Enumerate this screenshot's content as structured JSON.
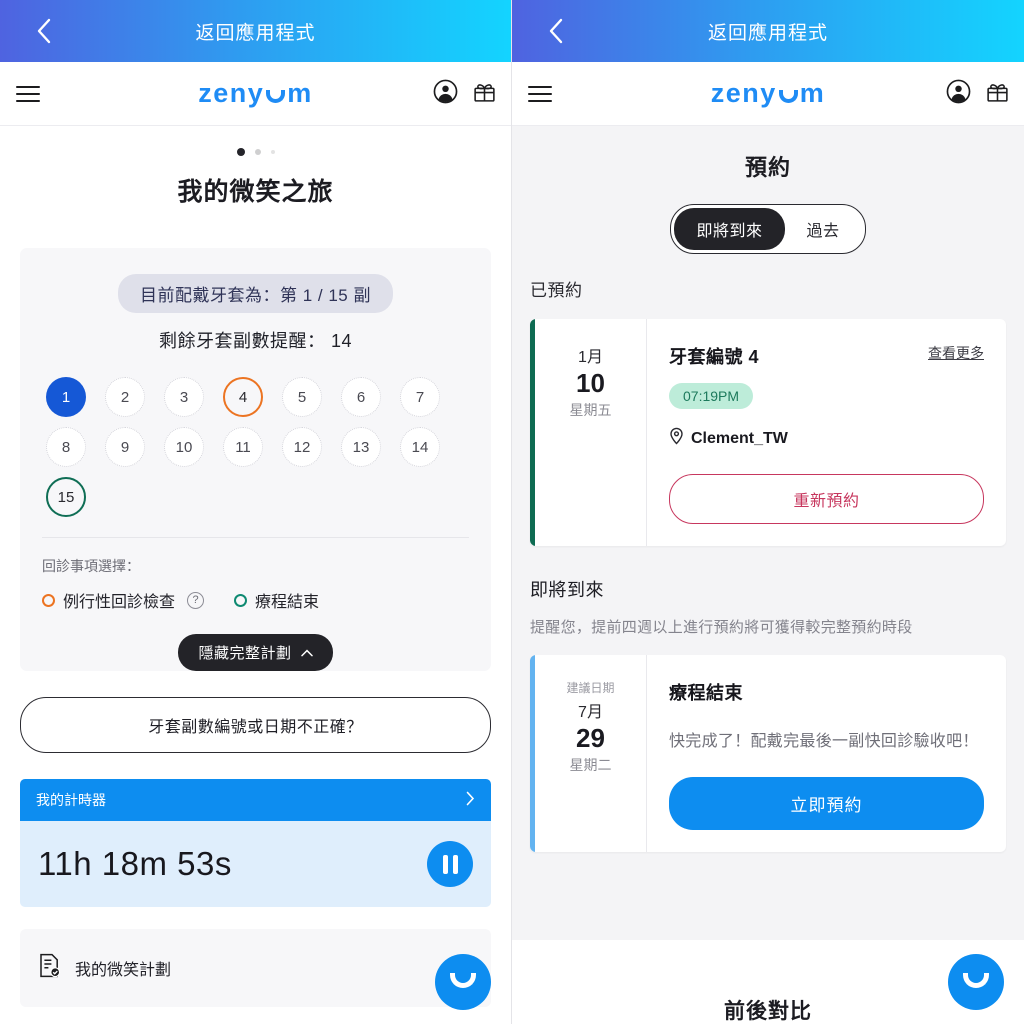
{
  "topbar": {
    "back_icon": "chevron-left-icon",
    "title": "返回應用程式"
  },
  "appbar": {
    "menu_icon": "hamburger-menu-icon",
    "brand_left": "zeny",
    "brand_right": "m",
    "account_icon": "account-circle-icon",
    "gift_icon": "gift-icon",
    "brand_color": "#1f8cf5"
  },
  "left": {
    "page_title": "我的微笑之旅",
    "carousel_dots": 3,
    "active_dot": 1,
    "chip": "目前配戴牙套為：第 1 / 15 副",
    "remaining": "剩餘牙套副數提醒： 14",
    "aligners": [
      {
        "n": "1",
        "state": "current"
      },
      {
        "n": "2",
        "state": "pending"
      },
      {
        "n": "3",
        "state": "pending"
      },
      {
        "n": "4",
        "state": "flagged"
      },
      {
        "n": "5",
        "state": "pending"
      },
      {
        "n": "6",
        "state": "pending"
      },
      {
        "n": "7",
        "state": "pending"
      },
      {
        "n": "8",
        "state": "pending"
      },
      {
        "n": "9",
        "state": "pending"
      },
      {
        "n": "10",
        "state": "pending"
      },
      {
        "n": "11",
        "state": "pending"
      },
      {
        "n": "12",
        "state": "pending"
      },
      {
        "n": "13",
        "state": "pending"
      },
      {
        "n": "14",
        "state": "pending"
      },
      {
        "n": "15",
        "state": "final"
      }
    ],
    "visit_label": "回診事項選擇：",
    "radio_routine": "例行性回診檢查",
    "radio_routine_color": "#ec7422",
    "help_icon": "question-mark-icon",
    "radio_finish": "療程結束",
    "radio_finish_color": "#0f8a72",
    "collapse_label": "隱藏完整計劃",
    "collapse_icon": "chevron-up-icon",
    "wrong_number_button": "牙套副數編號或日期不正確？",
    "timer_header": "我的計時器",
    "timer_chevron_icon": "chevron-right-icon",
    "timer_value": "11h 18m 53s",
    "pause_icon": "pause-icon",
    "plan_link_icon": "document-check-icon",
    "plan_link_label": "我的微笑計劃",
    "fab_icon": "zenyum-smile-icon"
  },
  "right": {
    "page_title": "預約",
    "segments": [
      {
        "label": "即將到來",
        "active": true
      },
      {
        "label": "過去",
        "active": false
      }
    ],
    "booked_label": "已預約",
    "booked_card": {
      "accent_color": "#0e6b52",
      "month": "1月",
      "day": "10",
      "weekday": "星期五",
      "name": "牙套編號 4",
      "more_link": "查看更多",
      "time": "07:19PM",
      "location_icon": "location-pin-icon",
      "location": "Clement_TW",
      "action": "重新預約",
      "action_color": "#c7375e"
    },
    "upcoming_label": "即將到來",
    "upcoming_note": "提醒您，提前四週以上進行預約將可獲得較完整預約時段",
    "upcoming_card": {
      "accent_color": "#63b3f0",
      "date_caption": "建議日期",
      "month": "7月",
      "day": "29",
      "weekday": "星期二",
      "name": "療程結束",
      "description": "快完成了！配戴完最後一副快回診驗收吧！",
      "action": "立即預約",
      "action_color": "#0d8df0"
    },
    "compare_title": "前後對比",
    "fab_icon": "zenyum-smile-icon"
  }
}
